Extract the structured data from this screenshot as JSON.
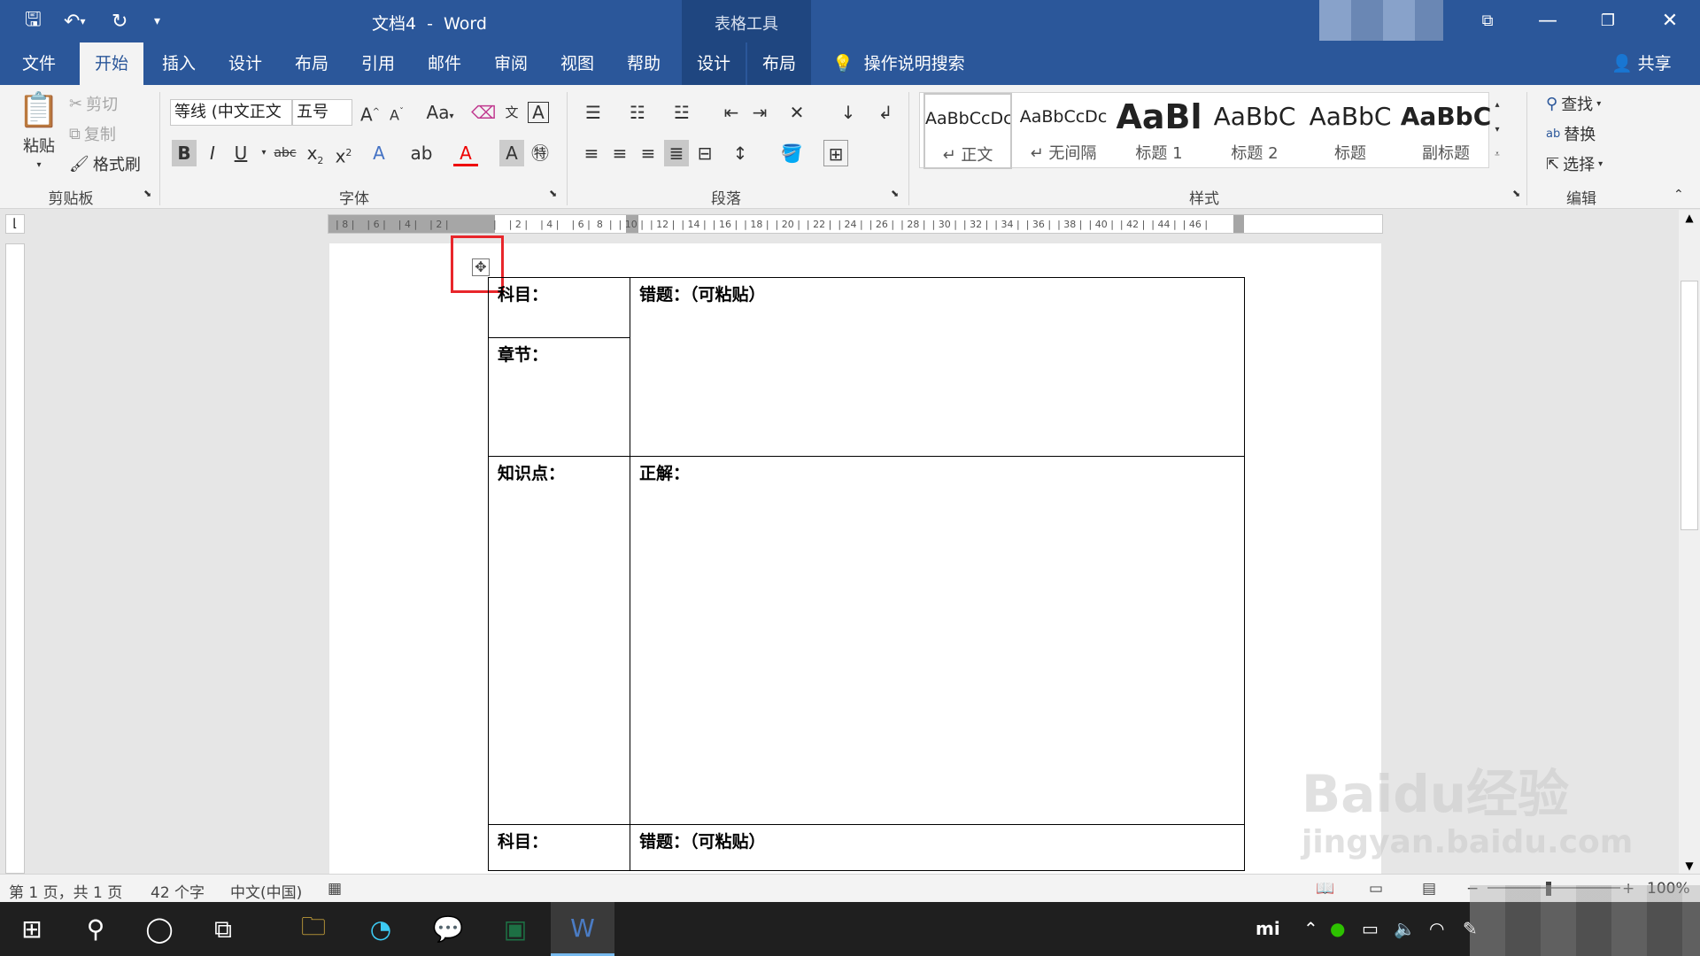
{
  "window": {
    "doc_name": "文档4",
    "dash": "-",
    "app_name": "Word",
    "context_tab_group": "表格工具"
  },
  "tabs": [
    {
      "label": "文件"
    },
    {
      "label": "开始"
    },
    {
      "label": "插入"
    },
    {
      "label": "设计"
    },
    {
      "label": "布局"
    },
    {
      "label": "引用"
    },
    {
      "label": "邮件"
    },
    {
      "label": "审阅"
    },
    {
      "label": "视图"
    },
    {
      "label": "帮助"
    },
    {
      "label": "设计"
    },
    {
      "label": "布局"
    }
  ],
  "tell_me": "操作说明搜索",
  "share": "共享",
  "clipboard": {
    "paste": "粘贴",
    "cut": "剪切",
    "copy": "复制",
    "format_painter": "格式刷",
    "label": "剪贴板"
  },
  "font": {
    "name": "等线 (中文正文",
    "size": "五号",
    "label": "字体",
    "change_case": "Aa",
    "bold": "B",
    "italic": "I",
    "underline": "U",
    "strike": "abc"
  },
  "paragraph": {
    "label": "段落"
  },
  "styles": {
    "label": "样式",
    "items": [
      {
        "preview": "AaBbCcDc",
        "name": "↵ 正文"
      },
      {
        "preview": "AaBbCcDc",
        "name": "↵ 无间隔"
      },
      {
        "preview": "AaBl",
        "name": "标题 1"
      },
      {
        "preview": "AaBbC",
        "name": "标题 2"
      },
      {
        "preview": "AaBbC",
        "name": "标题"
      },
      {
        "preview": "AaBbC",
        "name": "副标题"
      }
    ]
  },
  "editing": {
    "find": "查找",
    "replace": "替换",
    "select": "选择",
    "label": "编辑"
  },
  "ruler": {
    "left_marks": "| 8 |    | 6 |    | 4 |    | 2 |",
    "right_marks": "|    | 2 |    | 4 |    | 6 |  8  |  | 10 |  | 12 |  | 14 |  | 16 |  | 18 |  | 20 |  | 22 |  | 24 |  | 26 |  | 28 |  | 30 |  | 32 |  | 34 |  | 36 |  | 38 |  | 40 |  | 42 |  | 44 |  | 46 |"
  },
  "table": {
    "rows": [
      [
        "科目：",
        "错题：（可粘贴）"
      ],
      [
        "章节：",
        ""
      ],
      [
        "知识点：",
        "正解："
      ],
      [
        "科目：",
        "错题：（可粘贴）"
      ]
    ]
  },
  "status": {
    "page": "第 1 页，共 1 页",
    "words": "42 个字",
    "lang": "中文(中国)",
    "zoom": "100%"
  },
  "watermark": {
    "line1": "Baidu经验",
    "line2": "jingyan.baidu.com"
  }
}
